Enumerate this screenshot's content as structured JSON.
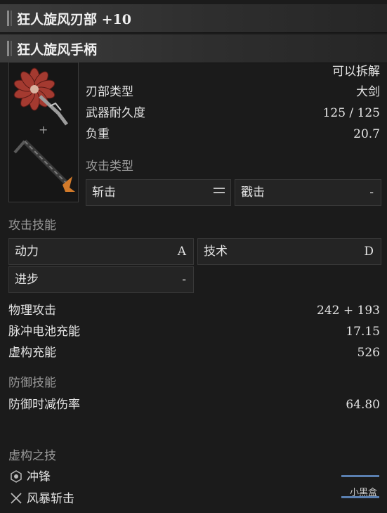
{
  "header": {
    "blade_title": "狂人旋风刃部 +10",
    "handle_title": "狂人旋风手柄"
  },
  "blade_info": {
    "detachable": "可以拆解",
    "blade_type_label": "刃部类型",
    "blade_type_value": "大剑",
    "durability_label": "武器耐久度",
    "durability_value": "125 / 125",
    "weight_label": "负重",
    "weight_value": "20.7",
    "attack_type_heading": "攻击类型",
    "attack_type_1_label": "斩击",
    "attack_type_2_label": "戳击",
    "attack_type_2_value": "-"
  },
  "attack_skills": {
    "heading": "攻击技能",
    "items": [
      {
        "label": "动力",
        "value": "A"
      },
      {
        "label": "技术",
        "value": "D"
      },
      {
        "label": "进步",
        "value": "-"
      }
    ]
  },
  "stats": [
    {
      "label": "物理攻击",
      "value": "242 + 193"
    },
    {
      "label": "脉冲电池充能",
      "value": "17.15"
    },
    {
      "label": "虚构充能",
      "value": "526"
    }
  ],
  "defense": {
    "heading": "防御技能",
    "label": "防御时减伤率",
    "value": "64.80"
  },
  "fable_arts": {
    "heading": "虚构之技",
    "items": [
      {
        "label": "冲锋",
        "icon": "badge-icon"
      },
      {
        "label": "风暴斩击",
        "icon": "crossed-swords-icon"
      }
    ]
  },
  "watermark": "小黑盒",
  "colors": {
    "bar": "#3c3c3c",
    "panel": "#242424",
    "accent": "#5a7fb0"
  }
}
